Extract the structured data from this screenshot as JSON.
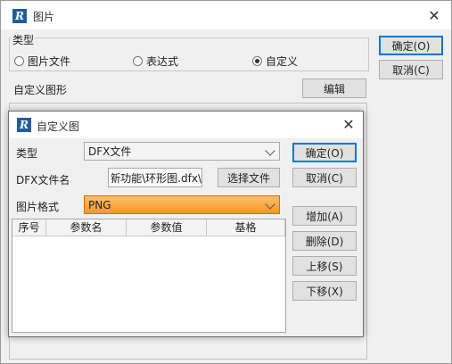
{
  "main": {
    "title": "图片",
    "app_icon": "R",
    "type_group_label": "类型",
    "radios": [
      {
        "label": "图片文件",
        "checked": false
      },
      {
        "label": "表达式",
        "checked": false
      },
      {
        "label": "自定义",
        "checked": true
      }
    ],
    "custom_shape_label": "自定义图形",
    "edit_button": "编辑",
    "ok_button": "确定(O)",
    "cancel_button": "取消(C)"
  },
  "dialog": {
    "title": "自定义图",
    "app_icon": "R",
    "type_label": "类型",
    "type_value": "DFX文件",
    "dfx_label": "DFX文件名",
    "dfx_value": "\\资料\\新功能\\环形图.dfx",
    "choose_file_button": "选择文件",
    "format_label": "图片格式",
    "format_value": "PNG",
    "ok_button": "确定(O)",
    "cancel_button": "取消(C)",
    "add_button": "增加(A)",
    "delete_button": "删除(D)",
    "up_button": "上移(S)",
    "down_button": "下移(X)",
    "columns": [
      "序号",
      "参数名",
      "参数值",
      "基格"
    ]
  },
  "colors": {
    "highlight_select": "#f7962b",
    "default_button_border": "#0078d7",
    "app_icon_bg": "#1f5d9b"
  },
  "icons": {
    "app": "r-logo-icon",
    "close": "close-icon",
    "dropdown": "chevron-down-icon"
  }
}
